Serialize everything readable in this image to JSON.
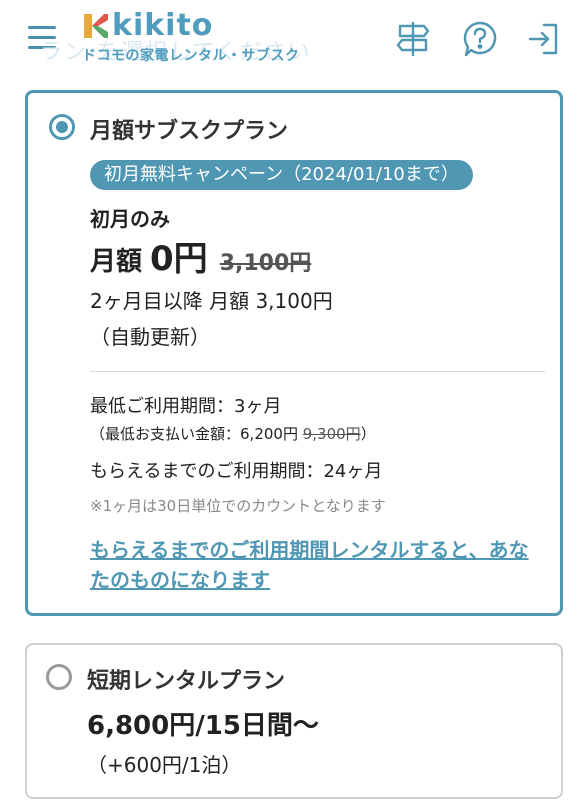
{
  "header": {
    "logo_text": "kikito",
    "logo_subtitle": "ドコモの家電レンタル・サブスク",
    "watermark": "ラン を選択してください",
    "icons": {
      "menu": "hamburger-menu-icon",
      "guide": "signpost-icon",
      "help": "question-icon",
      "login": "login-icon"
    }
  },
  "plans": {
    "subscription": {
      "title": "月額サブスクプラン",
      "campaign_badge": "初月無料キャンペーン（2024/01/10まで）",
      "first_month_label": "初月のみ",
      "monthly_prefix": "月額",
      "monthly_price": "0円",
      "original_price": "3,100円",
      "from_second_month": "2ヶ月目以降 月額 3,100円",
      "auto_renew": "（自動更新）",
      "min_period": "最低ご利用期間：3ヶ月",
      "min_payment_prefix": "（最低お支払い金額：6,200円",
      "min_payment_original": "9,300円",
      "min_payment_suffix": "）",
      "ownership_period": "もらえるまでのご利用期間：24ヶ月",
      "note": "※1ヶ月は30日単位でのカウントとなります",
      "link_text": "もらえるまでのご利用期間レンタルすると、あなたのものになります",
      "selected": true
    },
    "short_term": {
      "title": "短期レンタルプラン",
      "price": "6,800円/15日間〜",
      "extra": "（+600円/1泊）",
      "selected": false
    }
  },
  "colors": {
    "accent": "#4f97b3",
    "text": "#222222",
    "muted": "#888888"
  }
}
